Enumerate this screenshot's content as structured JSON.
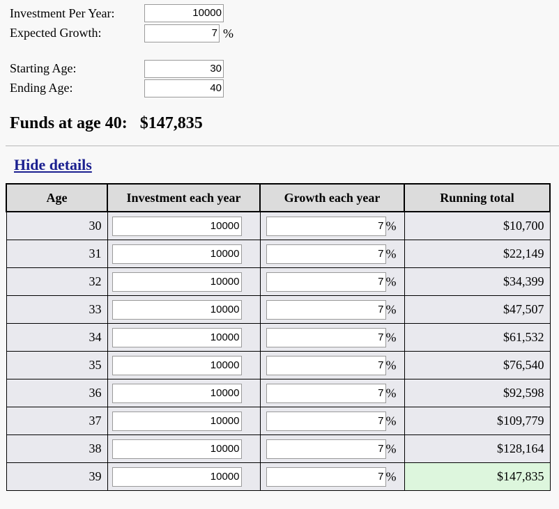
{
  "form": {
    "investment_label": "Investment Per Year:",
    "currency_symbol": "$",
    "investment_value": "10000",
    "growth_label": "Expected Growth:",
    "growth_value": "7",
    "percent_sign": "%",
    "start_age_label": "Starting Age:",
    "start_age_value": "30",
    "end_age_label": "Ending Age:",
    "end_age_value": "40"
  },
  "summary": {
    "label": "Funds at age 40:",
    "value": "$147,835"
  },
  "toggle_label": "Hide details",
  "table": {
    "headers": [
      "Age",
      "Investment each year",
      "Growth each year",
      "Running total"
    ],
    "rows": [
      {
        "age": "30",
        "investment": "10000",
        "growth": "7",
        "total": "$10,700"
      },
      {
        "age": "31",
        "investment": "10000",
        "growth": "7",
        "total": "$22,149"
      },
      {
        "age": "32",
        "investment": "10000",
        "growth": "7",
        "total": "$34,399"
      },
      {
        "age": "33",
        "investment": "10000",
        "growth": "7",
        "total": "$47,507"
      },
      {
        "age": "34",
        "investment": "10000",
        "growth": "7",
        "total": "$61,532"
      },
      {
        "age": "35",
        "investment": "10000",
        "growth": "7",
        "total": "$76,540"
      },
      {
        "age": "36",
        "investment": "10000",
        "growth": "7",
        "total": "$92,598"
      },
      {
        "age": "37",
        "investment": "10000",
        "growth": "7",
        "total": "$109,779"
      },
      {
        "age": "38",
        "investment": "10000",
        "growth": "7",
        "total": "$128,164"
      },
      {
        "age": "39",
        "investment": "10000",
        "growth": "7",
        "total": "$147,835"
      }
    ],
    "highlight_color": "#ddf6dd"
  }
}
